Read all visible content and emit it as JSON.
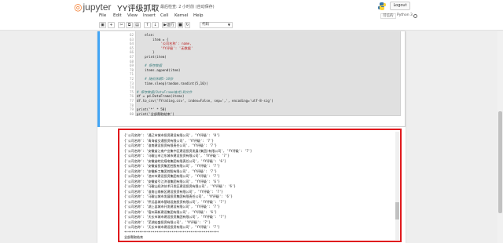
{
  "header": {
    "logo_text": "jupyter",
    "notebook_title": "YY评级抓取",
    "checkpoint": "最后检查: 2 小时前 (自动保存)",
    "logout_label": "Logout"
  },
  "menu": {
    "items": [
      "File",
      "Edit",
      "View",
      "Insert",
      "Cell",
      "Kernel",
      "Help"
    ],
    "trusted": "可信的",
    "kernel_name": "Python 3"
  },
  "toolbar": {
    "buttons": [
      "save-icon",
      "plus-icon",
      "cut-icon",
      "copy-icon",
      "paste-icon",
      "arrow-up-icon",
      "arrow-down-icon",
      "run-icon",
      "stop-icon",
      "restart-icon",
      "fast-forward-icon"
    ],
    "run_label": "运行",
    "cell_type": "代码"
  },
  "code": {
    "lines": [
      {
        "n": "62",
        "t": "    else:"
      },
      {
        "n": "63",
        "t": "        item = {"
      },
      {
        "n": "64",
        "t": "            '公司名称': name,"
      },
      {
        "n": "65",
        "t": "            'YY评级': '无数据'"
      },
      {
        "n": "66",
        "t": "        }"
      },
      {
        "n": "67",
        "t": "    print(item)"
      },
      {
        "n": "68",
        "t": ""
      },
      {
        "n": "69",
        "t": "    # 保存数据"
      },
      {
        "n": "70",
        "t": "    items.append(item)"
      },
      {
        "n": "71",
        "t": ""
      },
      {
        "n": "72",
        "t": "    # 随机休眠5-10秒"
      },
      {
        "n": "73",
        "t": "    time.sleep(random.randint(5,10))"
      },
      {
        "n": "74",
        "t": ""
      },
      {
        "n": "75",
        "t": "# 保存数据(DataFrame格式)到文件"
      },
      {
        "n": "76",
        "t": "df = pd.DataFrame(items)"
      },
      {
        "n": "77",
        "t": "df.to_csv('YYrating.csv', index=False, sep=',', encoding='utf-8-sig')"
      },
      {
        "n": "78",
        "t": ""
      },
      {
        "n": "79",
        "t": "print('*' * 50)"
      },
      {
        "n": "80",
        "t": "print('全部爬取结束')"
      }
    ]
  },
  "output": {
    "lines": [
      "{'公司名称': '通辽市城市投资建设有限公司', 'YY评级': '8'}",
      "{'公司名称': '青海省交通投资有限公司', 'YY评级': '7'}",
      "{'公司名称': '淮南建设投资有限责任公司', 'YY评级': '7'}",
      "{'公司名称': '安徽省江南产业集中区建设投资发展(集团)有限公司', 'YY评级': '7'}",
      "{'公司名称': '马鞍山市江东城市建设投资有限公司', 'YY评级': '7'}",
      "{'公司名称': '安徽省皖北煤电集团有限责任公司', 'YY评级': '6'}",
      "{'公司名称': '安徽省投资集团控股有限公司', 'YY评级': '7'}",
      "{'公司名称': '安徽新工集团控股有限公司', 'YY评级': '7'}",
      "{'公司名称': '池州市建设投资集团有限公司', 'YY评级': '7'}",
      "{'公司名称': '安徽省引江济淮集团有限公司', 'YY评级': '6'}",
      "{'公司名称': '马鞍山经济技术开发区建设投资有限公司', 'YY评级': '6'}",
      "{'公司名称': '淮南山南新区建设投资有限公司', 'YY评级': '7'}",
      "{'公司名称': '马鞍山城市发展投资集团有限责任公司', 'YY评级': '6'}",
      "{'公司名称': '怀远县城市基础设施投资有限公司', 'YY评级': '7'}",
      "{'公司名称': '湖上县城市开发建设有限公司', 'YY评级': '7'}",
      "{'公司名称': '宿州高新建设集团有限公司', 'YY评级': '6'}",
      "{'公司名称': '天长市城市建设投资集团有限公司', 'YY评级': '7'}",
      "{'公司名称': '芜湖宏盛投资有限公司', 'YY评级': '7'}",
      "{'公司名称': '天长市城市建设投资有限公司', 'YY评级': '7'}",
      "**************************************************",
      "全部爬取结束"
    ]
  },
  "colors": {
    "accent": "#42a5f5",
    "highlight_box": "#e0191d",
    "jupyter_orange": "#f37726"
  }
}
